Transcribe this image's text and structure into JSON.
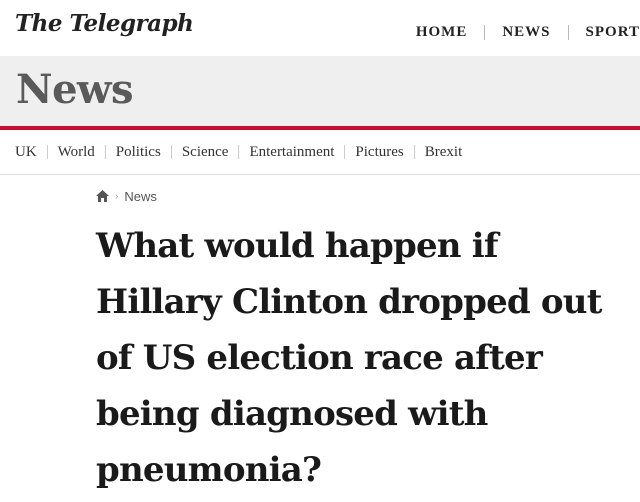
{
  "header": {
    "logo_text": "The Telegraph",
    "nav": [
      "HOME",
      "NEWS",
      "SPORT"
    ]
  },
  "section": {
    "title": "News",
    "accent_color": "#c8102e"
  },
  "subnav": [
    "UK",
    "World",
    "Politics",
    "Science",
    "Entertainment",
    "Pictures",
    "Brexit"
  ],
  "breadcrumb": {
    "home_icon": "home-icon",
    "current": "News"
  },
  "article": {
    "headline": "What would happen if Hillary Clinton dropped out of US election race after being diagnosed with pneumonia?"
  }
}
